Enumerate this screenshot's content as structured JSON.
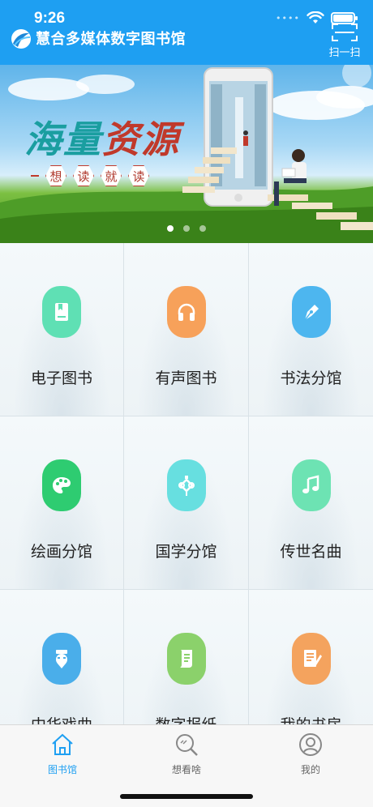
{
  "status_bar": {
    "time": "9:26",
    "signal": "••••"
  },
  "header": {
    "title": "慧合多媒体数字图书馆",
    "scan_label": "扫一扫"
  },
  "banner": {
    "headline_part1": "海量",
    "headline_part2": "资源",
    "slogan": [
      "想",
      "读",
      "就",
      "读"
    ],
    "slide_count": 3,
    "active_slide": 0
  },
  "grid": {
    "items": [
      {
        "label": "电子图书",
        "icon": "book-icon",
        "color": "#5fe0b4"
      },
      {
        "label": "有声图书",
        "icon": "headphones-icon",
        "color": "#f7a15a"
      },
      {
        "label": "书法分馆",
        "icon": "pen-nib-icon",
        "color": "#4db6ef"
      },
      {
        "label": "绘画分馆",
        "icon": "palette-icon",
        "color": "#2ecc71"
      },
      {
        "label": "国学分馆",
        "icon": "chinese-knot-icon",
        "color": "#67dfe0"
      },
      {
        "label": "传世名曲",
        "icon": "music-note-icon",
        "color": "#6de3b3"
      },
      {
        "label": "中华戏曲",
        "icon": "opera-mask-icon",
        "color": "#4aaeea"
      },
      {
        "label": "数字报纸",
        "icon": "newspaper-icon",
        "color": "#8bd16b"
      },
      {
        "label": "我的书房",
        "icon": "notes-icon",
        "color": "#f4a35e"
      }
    ]
  },
  "tabbar": {
    "accent": "#1e9ff2",
    "tabs": [
      {
        "label": "图书馆",
        "icon": "home-icon",
        "active": true
      },
      {
        "label": "想看啥",
        "icon": "search-icon",
        "active": false
      },
      {
        "label": "我的",
        "icon": "user-icon",
        "active": false
      }
    ]
  }
}
